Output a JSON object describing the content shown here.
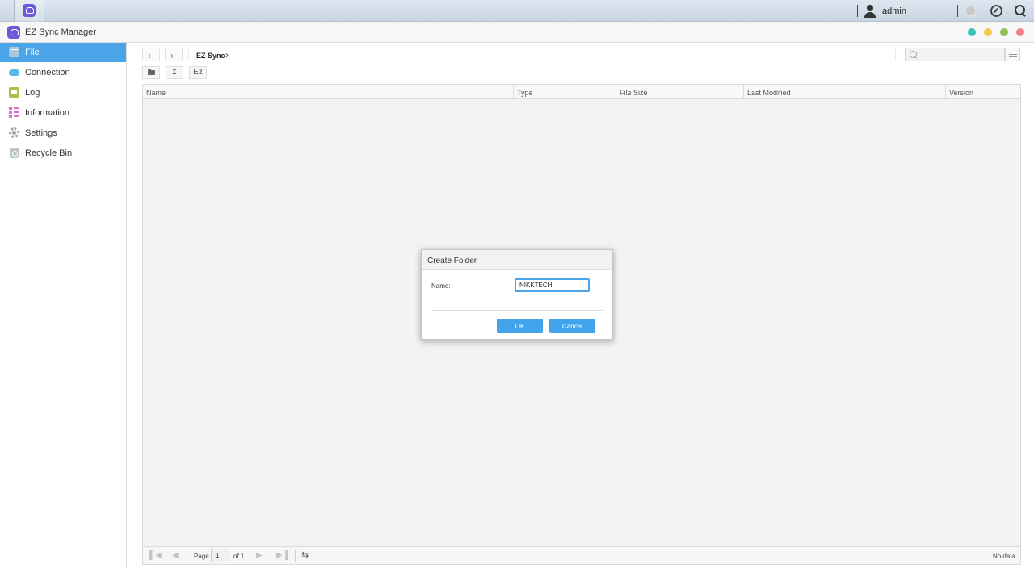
{
  "taskbar": {
    "user": "admin"
  },
  "window": {
    "title": "EZ Sync Manager",
    "controls": [
      "#3fc1c0",
      "#f2c94c",
      "#8dc153",
      "#f07f8a"
    ]
  },
  "sidebar": {
    "items": [
      {
        "label": "File",
        "icon": "file-icon",
        "active": true
      },
      {
        "label": "Connection",
        "icon": "cloud-icon"
      },
      {
        "label": "Log",
        "icon": "log-icon"
      },
      {
        "label": "Information",
        "icon": "list-icon"
      },
      {
        "label": "Settings",
        "icon": "gear-icon"
      },
      {
        "label": "Recycle Bin",
        "icon": "recycle-bin-icon"
      }
    ]
  },
  "main": {
    "breadcrumb": "EZ Sync",
    "toolbar": {
      "ez_label": "Ez"
    },
    "columns": [
      "Name",
      "Type",
      "File Size",
      "Last Modified",
      "Version"
    ],
    "pager": {
      "page_label": "Page",
      "page_value": "1",
      "of_label": "of 1",
      "status": "No data"
    }
  },
  "dialog": {
    "title": "Create Folder",
    "name_label": "Name:",
    "name_value": "NIKKTECH",
    "ok_label": "OK",
    "cancel_label": "Cancel"
  },
  "colors": {
    "accent": "#4ba3e8",
    "brand": "#6c5bd8"
  }
}
